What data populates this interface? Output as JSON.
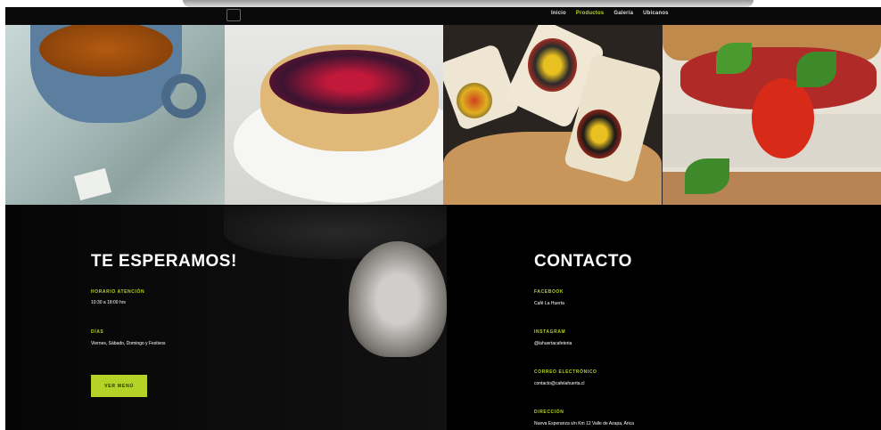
{
  "nav": {
    "items": [
      "Inicio",
      "Productos",
      "Galería",
      "Ubicanos"
    ],
    "active_index": 1
  },
  "gallery": {
    "tiles": [
      "tea-cup-photo",
      "berry-tart-photo",
      "burrito-wraps-photo",
      "sandwich-photo"
    ]
  },
  "hours": {
    "title": "TE ESPERAMOS!",
    "schedule_label": "HORARIO ATENCIÓN",
    "schedule_value": "10:30 a 18:00 hrs",
    "days_label": "DÍAS",
    "days_value": "Viernes, Sábado, Domingo y Festivos",
    "button_label": "VER MENÚ"
  },
  "contact": {
    "title": "CONTACTO",
    "facebook_label": "FACEBOOK",
    "facebook_value": "Café La Huerta",
    "instagram_label": "INSTAGRAM",
    "instagram_value": "@lahuertacafeteria",
    "email_label": "CORREO ELECTRÓNICO",
    "email_value": "contacto@cafelahuerta.cl",
    "address_label": "DIRECCIÓN",
    "address_value": "Nueva Esperanza s/n Km 12 Valle de Azapa, Arica"
  },
  "colors": {
    "accent": "#b5d327",
    "background": "#000000",
    "text": "#ffffff"
  }
}
